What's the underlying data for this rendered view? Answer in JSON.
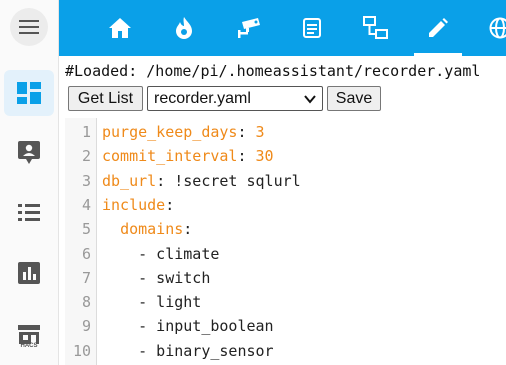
{
  "topbar": {
    "tabs": [
      {
        "icon": "home-icon"
      },
      {
        "icon": "flame-icon"
      },
      {
        "icon": "cctv-icon"
      },
      {
        "icon": "document-icon"
      },
      {
        "icon": "network-icon"
      },
      {
        "icon": "pencil-icon",
        "active": true
      },
      {
        "icon": "globe-icon"
      }
    ]
  },
  "sidebar": {
    "items": [
      {
        "icon": "dashboard-icon",
        "active": true
      },
      {
        "icon": "person-card-icon"
      },
      {
        "icon": "list-icon"
      },
      {
        "icon": "bar-chart-icon"
      },
      {
        "icon": "hacs-store-icon",
        "label": "HACS"
      }
    ]
  },
  "toolbar": {
    "loaded_text": "#Loaded: /home/pi/.homeassistant/recorder.yaml",
    "get_list_label": "Get List",
    "selected_file": "recorder.yaml",
    "save_label": "Save"
  },
  "editor": {
    "lines": [
      {
        "n": "1",
        "text": "purge_keep_days: 3"
      },
      {
        "n": "2",
        "text": "commit_interval: 30"
      },
      {
        "n": "3",
        "text": "db_url: !secret sqlurl"
      },
      {
        "n": "4",
        "text": "include:"
      },
      {
        "n": "5",
        "text": "  domains:"
      },
      {
        "n": "6",
        "text": "    - climate"
      },
      {
        "n": "7",
        "text": "    - switch"
      },
      {
        "n": "8",
        "text": "    - light"
      },
      {
        "n": "9",
        "text": "    - input_boolean"
      },
      {
        "n": "10",
        "text": "    - binary_sensor"
      }
    ]
  },
  "colors": {
    "accent": "#0aa0e8",
    "key": "#ef8a1a"
  }
}
